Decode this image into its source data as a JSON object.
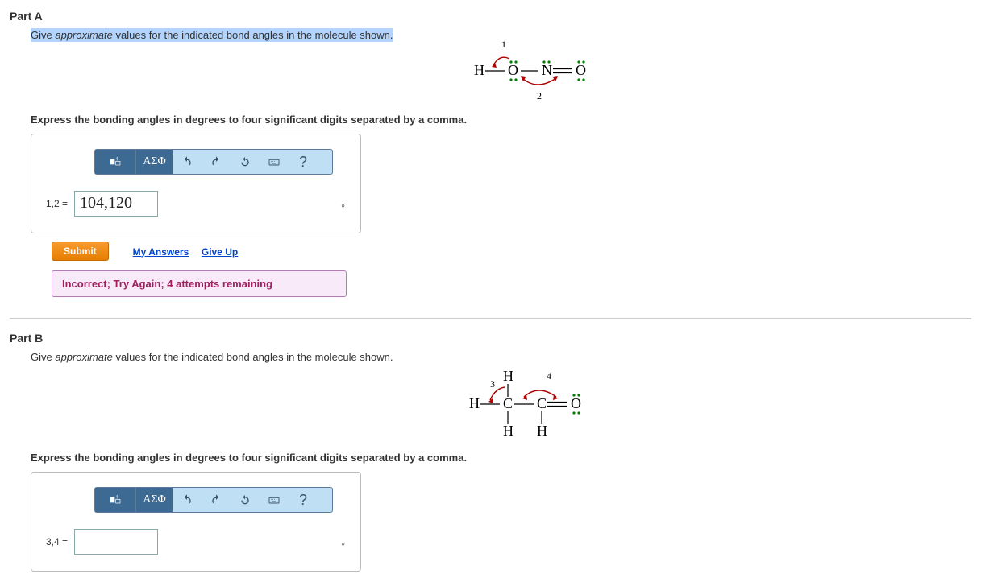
{
  "partA": {
    "title": "Part A",
    "instruction_pre": "Give ",
    "instruction_em": "approximate",
    "instruction_post": " values for the indicated bond angles in the molecule shown.",
    "sub_instruction": "Express the bonding angles in degrees to four significant digits separated by a comma.",
    "eq_label": "1,2 =",
    "eq_value": "104,120",
    "degree": "∘",
    "submit_label": "Submit",
    "my_answers": "My Answers",
    "give_up": "Give Up",
    "feedback": "Incorrect; Try Again; 4 attempts remaining",
    "toolbar": {
      "greek": "ΑΣΦ",
      "help": "?"
    },
    "molecule": {
      "label1": "1",
      "label2": "2",
      "atoms": [
        "H",
        "O",
        "N",
        "O"
      ]
    }
  },
  "partB": {
    "title": "Part B",
    "instruction_pre": "Give ",
    "instruction_em": "approximate",
    "instruction_post": " values for the indicated bond angles in the molecule shown.",
    "sub_instruction": "Express the bonding angles in degrees to four significant digits separated by a comma.",
    "eq_label": "3,4 =",
    "eq_value": "",
    "degree": "∘",
    "toolbar": {
      "greek": "ΑΣΦ",
      "help": "?"
    },
    "molecule": {
      "label3": "3",
      "label4": "4"
    }
  }
}
